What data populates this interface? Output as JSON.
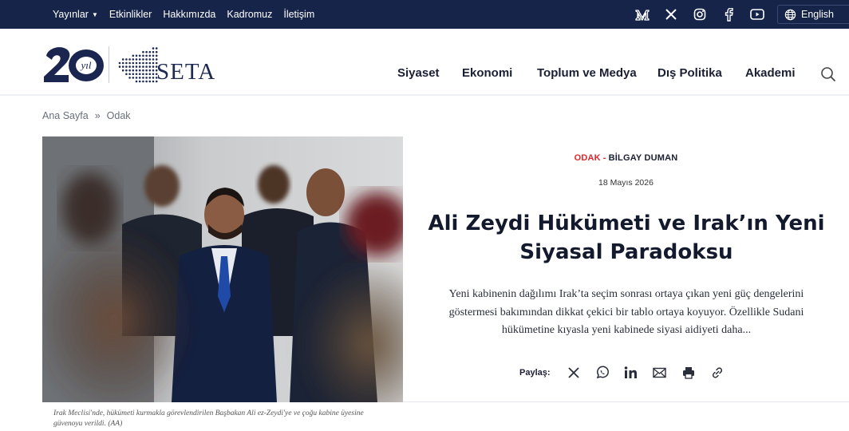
{
  "topnav": {
    "items": [
      "Yayınlar",
      "Etkinlikler",
      "Hakkımızda",
      "Kadromuz",
      "İletişim"
    ],
    "language": "English"
  },
  "social_icons": [
    "medium-icon",
    "x-icon",
    "instagram-icon",
    "facebook-icon",
    "youtube-icon"
  ],
  "header": {
    "logo_badge": "yıl",
    "logo_text": "SETA",
    "nav": [
      "Siyaset",
      "Ekonomi",
      "Toplum ve Medya",
      "Dış Politika",
      "Akademi"
    ]
  },
  "breadcrumb": {
    "home": "Ana Sayfa",
    "separator": "»",
    "current": "Odak"
  },
  "article": {
    "category": "ODAK",
    "dash": "-",
    "author": "BİLGAY DUMAN",
    "date": "18 Mayıs 2026",
    "title": "Ali Zeydi Hükümeti ve Irak’ın Yeni Siyasal Paradoksu",
    "excerpt": "Yeni kabinenin dağılımı Irak’ta seçim sonrası ortaya çıkan yeni güç dengelerini göstermesi bakımından dikkat çekici bir tablo ortaya koyuyor. Özellikle Sudani hükümetine kıyasla yeni kabinede siyasi aidiyeti daha...",
    "caption": "Irak Meclisi'nde, hükümeti kurmakla görevlendirilen Başbakan Ali ez-Zeydi'ye ve çoğu kabine üyesine güvenoyu verildi. (AA)",
    "share_label": "Paylaş:"
  },
  "share_icons": [
    "x-icon",
    "whatsapp-icon",
    "linkedin-icon",
    "email-icon",
    "print-icon",
    "link-icon"
  ],
  "colors": {
    "topbar": "#16244a",
    "accent_red": "#e2262b",
    "brand_navy": "#1d2a52"
  }
}
